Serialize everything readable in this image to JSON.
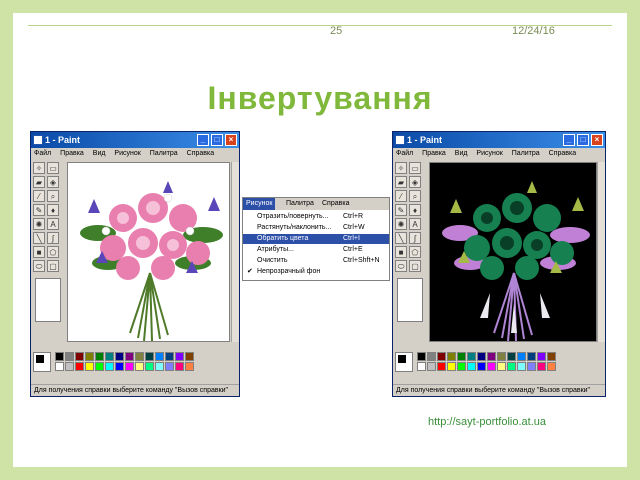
{
  "slide": {
    "number": "25",
    "date": "12/24/16",
    "title": "Інвертування",
    "url": "http://sayt-portfolio.at.ua"
  },
  "left_window": {
    "title": "1 - Paint",
    "menu": [
      "Файл",
      "Правка",
      "Вид",
      "Рисунок",
      "Палитра",
      "Справка"
    ],
    "status": "Для получения справки выберите команду \"Вызов справки\""
  },
  "right_window": {
    "title": "1 - Paint",
    "menu": [
      "Файл",
      "Правка",
      "Вид",
      "Рисунок",
      "Палитра",
      "Справка"
    ],
    "status": "Для получения справки выберите команду \"Вызов справки\""
  },
  "menu_popup": {
    "bar": [
      "Рисунок",
      "Палитра",
      "Справка"
    ],
    "items": [
      {
        "label": "Отразить/повернуть...",
        "shortcut": "Ctrl+R",
        "checked": false
      },
      {
        "label": "Растянуть/наклонить...",
        "shortcut": "Ctrl+W",
        "checked": false
      },
      {
        "label": "Обратить цвета",
        "shortcut": "Ctrl+I",
        "checked": false,
        "highlighted": true
      },
      {
        "label": "Атрибуты...",
        "shortcut": "Ctrl+E",
        "checked": false
      },
      {
        "label": "Очистить",
        "shortcut": "Ctrl+Shft+N",
        "checked": false
      },
      {
        "label": "Непрозрачный фон",
        "shortcut": "",
        "checked": true
      }
    ]
  },
  "palette_colors": [
    "#000000",
    "#808080",
    "#800000",
    "#808000",
    "#008000",
    "#008080",
    "#000080",
    "#800080",
    "#808040",
    "#004040",
    "#0080ff",
    "#004080",
    "#8000ff",
    "#804000",
    "#ffffff",
    "#c0c0c0",
    "#ff0000",
    "#ffff00",
    "#00ff00",
    "#00ffff",
    "#0000ff",
    "#ff00ff",
    "#ffff80",
    "#00ff80",
    "#80ffff",
    "#8080ff",
    "#ff0080",
    "#ff8040"
  ],
  "colors": {
    "accent": "#7fb83a",
    "frame": "#cfe3a6",
    "menu_highlight": "#2c4fa8"
  }
}
